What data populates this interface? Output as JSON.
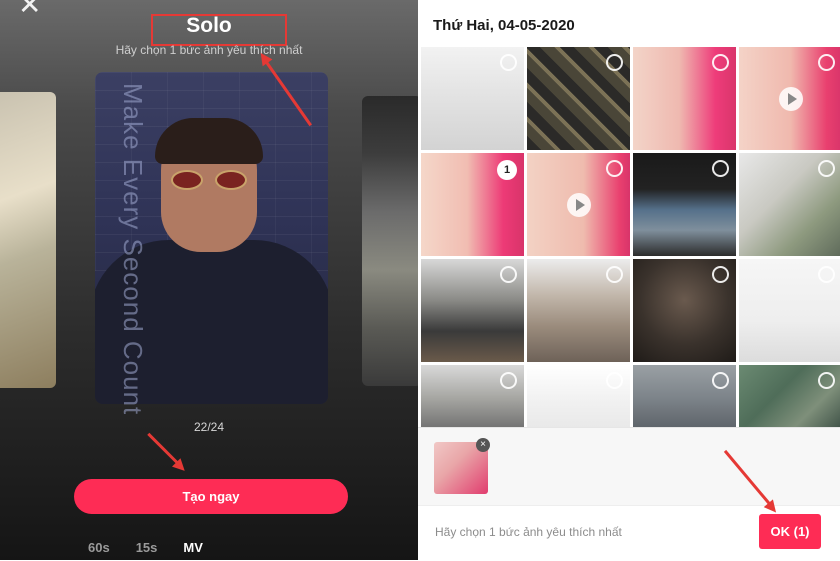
{
  "left_panel": {
    "title": "Solo",
    "subtitle": "Hãy chọn 1 bức ảnh yêu thích nhất",
    "card_overlay_text": "Make Every Second Count",
    "counter": "22/24",
    "create_button": "Tạo ngay",
    "tabs": [
      {
        "label": "60s",
        "active": false
      },
      {
        "label": "15s",
        "active": false
      },
      {
        "label": "MV",
        "active": true
      }
    ]
  },
  "right_panel": {
    "date_header": "Thứ Hai, 04-05-2020",
    "selected_badge": "1",
    "hint": "Hãy chọn 1 bức ảnh yêu thích nhất",
    "ok_button": "OK (1)",
    "close_glyph": "×"
  },
  "colors": {
    "accent": "#fe2c55",
    "annotation_red": "#e53935"
  },
  "icons": [
    "close-icon",
    "play-icon",
    "select-circle-icon",
    "remove-icon"
  ]
}
